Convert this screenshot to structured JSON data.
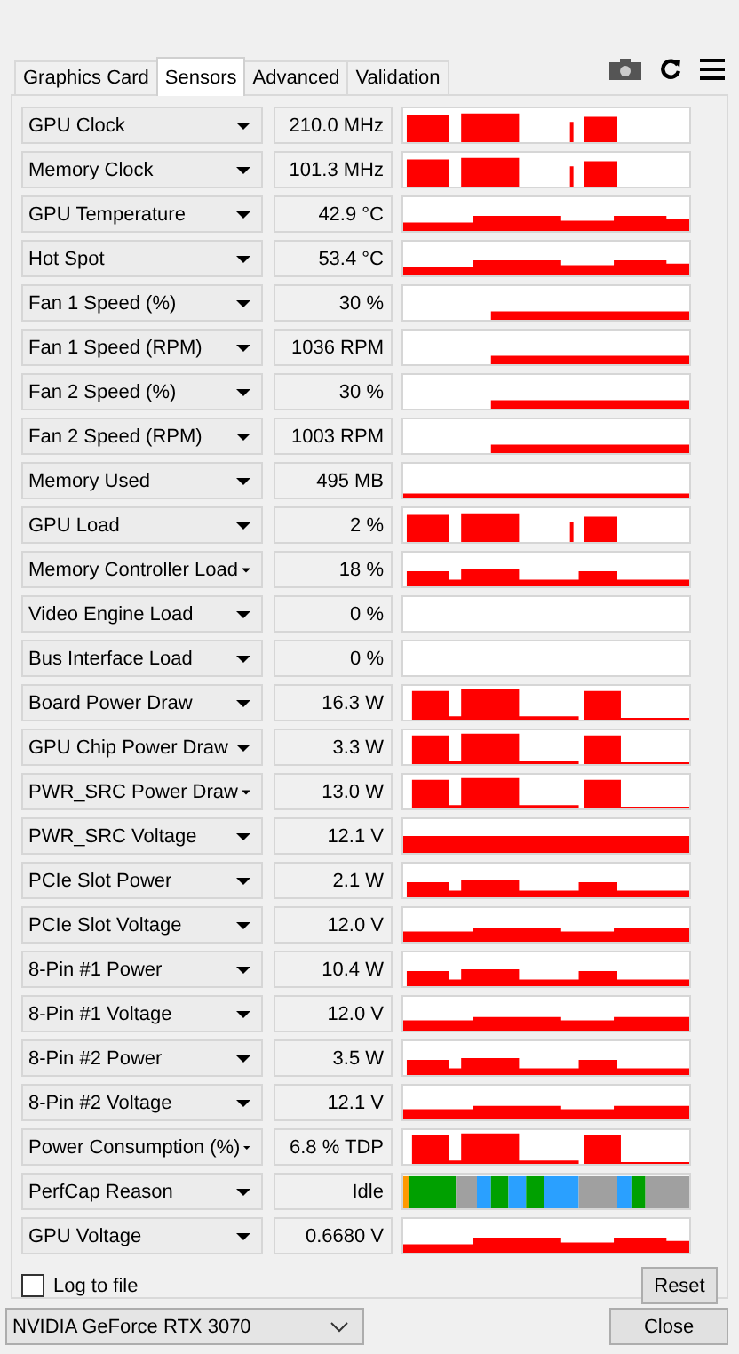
{
  "tabs": [
    {
      "label": "Graphics Card",
      "selected": false
    },
    {
      "label": "Sensors",
      "selected": true
    },
    {
      "label": "Advanced",
      "selected": false
    },
    {
      "label": "Validation",
      "selected": false
    }
  ],
  "sensors": [
    {
      "label": "GPU Clock",
      "value": "210.0 MHz",
      "kind": "bursts"
    },
    {
      "label": "Memory Clock",
      "value": "101.3 MHz",
      "kind": "bursts"
    },
    {
      "label": "GPU Temperature",
      "value": "42.9 °C",
      "kind": "hump"
    },
    {
      "label": "Hot Spot",
      "value": "53.4 °C",
      "kind": "hump"
    },
    {
      "label": "Fan 1 Speed (%)",
      "value": "30 %",
      "kind": "fan"
    },
    {
      "label": "Fan 1 Speed (RPM)",
      "value": "1036 RPM",
      "kind": "fan"
    },
    {
      "label": "Fan 2 Speed (%)",
      "value": "30 %",
      "kind": "fan"
    },
    {
      "label": "Fan 2 Speed (RPM)",
      "value": "1003 RPM",
      "kind": "fan"
    },
    {
      "label": "Memory Used",
      "value": "495 MB",
      "kind": "thin"
    },
    {
      "label": "GPU Load",
      "value": "2 %",
      "kind": "bursts"
    },
    {
      "label": "Memory Controller Load",
      "value": "18 %",
      "kind": "low"
    },
    {
      "label": "Video Engine Load",
      "value": "0 %",
      "kind": "empty"
    },
    {
      "label": "Bus Interface Load",
      "value": "0 %",
      "kind": "empty"
    },
    {
      "label": "Board Power Draw",
      "value": "16.3 W",
      "kind": "power"
    },
    {
      "label": "GPU Chip Power Draw",
      "value": "3.3 W",
      "kind": "power"
    },
    {
      "label": "PWR_SRC Power Draw",
      "value": "13.0 W",
      "kind": "power"
    },
    {
      "label": "PWR_SRC Voltage",
      "value": "12.1 V",
      "kind": "full"
    },
    {
      "label": "PCIe Slot Power",
      "value": "2.1 W",
      "kind": "low"
    },
    {
      "label": "PCIe Slot Voltage",
      "value": "12.0 V",
      "kind": "volt"
    },
    {
      "label": "8-Pin #1 Power",
      "value": "10.4 W",
      "kind": "low"
    },
    {
      "label": "8-Pin #1 Voltage",
      "value": "12.0 V",
      "kind": "volt"
    },
    {
      "label": "8-Pin #2 Power",
      "value": "3.5 W",
      "kind": "low"
    },
    {
      "label": "8-Pin #2 Voltage",
      "value": "12.1 V",
      "kind": "volt"
    },
    {
      "label": "Power Consumption (%)",
      "value": "6.8 % TDP",
      "kind": "power"
    },
    {
      "label": "PerfCap Reason",
      "value": "Idle",
      "kind": "perfcap"
    },
    {
      "label": "GPU Voltage",
      "value": "0.6680 V",
      "kind": "hump"
    }
  ],
  "log_to_file": {
    "label": "Log to file",
    "checked": false
  },
  "reset_button": "Reset",
  "gpu_select": "NVIDIA GeForce RTX 3070",
  "close_button": "Close"
}
